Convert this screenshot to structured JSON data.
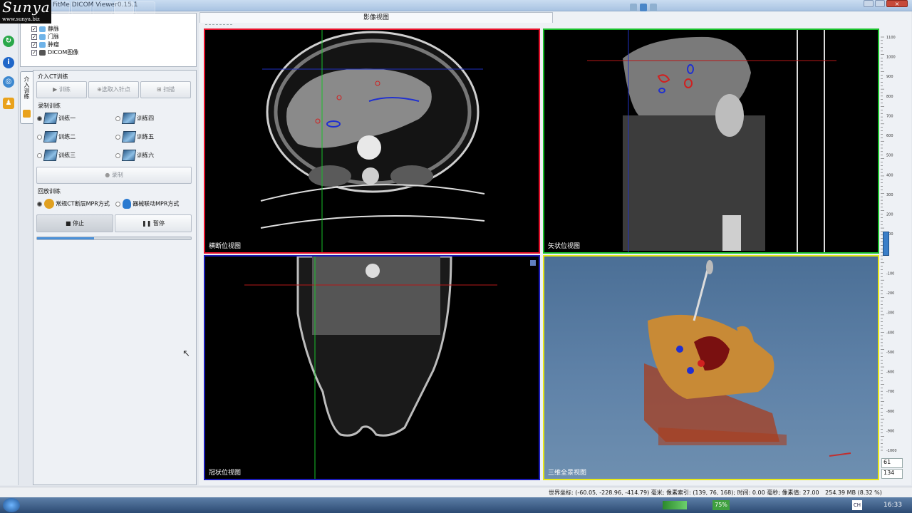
{
  "logo": {
    "brand": "Sunya",
    "url": "www.sunya.biz"
  },
  "app_title": "FitMe DICOM Viewer0.15.1",
  "tree": {
    "items": [
      {
        "label": "静脉",
        "checked": true
      },
      {
        "label": "门脉",
        "checked": true
      },
      {
        "label": "肿瘤",
        "checked": true
      },
      {
        "label": "DICOM图像",
        "checked": true
      }
    ]
  },
  "side_tab": "介入训练",
  "ct_training": {
    "title": "介入CT训练",
    "btn_train": "训练",
    "btn_select": "选取入针点",
    "btn_scan": "扫描"
  },
  "record_training": {
    "title": "录制训练",
    "options": [
      "训练一",
      "训练四",
      "训练二",
      "训练五",
      "训练三",
      "训练六"
    ],
    "selected": "训练一",
    "record_button": "录制"
  },
  "playback_training": {
    "title": "回放训练",
    "mode1": "常规CT断层MPR方式",
    "mode2": "器械联动MPR方式",
    "selected": "常规CT断层MPR方式",
    "stop_button": "停止",
    "pause_button": "暂停",
    "progress": 0.37
  },
  "main_tab": "影像视图",
  "views": {
    "axial": {
      "label": "横断位视图",
      "border": "#e8102a"
    },
    "sagittal": {
      "label": "矢状位视图",
      "border": "#18c02a"
    },
    "coronal": {
      "label": "冠状位视图",
      "border": "#1a1ab8"
    },
    "three_d": {
      "label": "三维全景视图",
      "border": "#e8e818"
    }
  },
  "ruler": {
    "ticks": [
      "1100",
      "1000",
      "900",
      "800",
      "700",
      "600",
      "500",
      "400",
      "300",
      "200",
      "100",
      "0",
      "-100",
      "-200",
      "-300",
      "-400",
      "-500",
      "-600",
      "-700",
      "-800",
      "-900",
      "-1000"
    ],
    "window": "61",
    "level": "134",
    "slider_level": 0.5
  },
  "status": {
    "world": "世界坐标: (-60.05, -228.96, -414.79) 毫米;",
    "pixel_index": "像素索引: (139, 76, 168);",
    "time": "时间: 0.00 毫秒;",
    "pixel_value": "像素值: 27.00",
    "memory": "254.39 MB (8.32 %)"
  },
  "taskbar": {
    "battery": "75%",
    "clock": "16:33",
    "lang": "CH"
  }
}
